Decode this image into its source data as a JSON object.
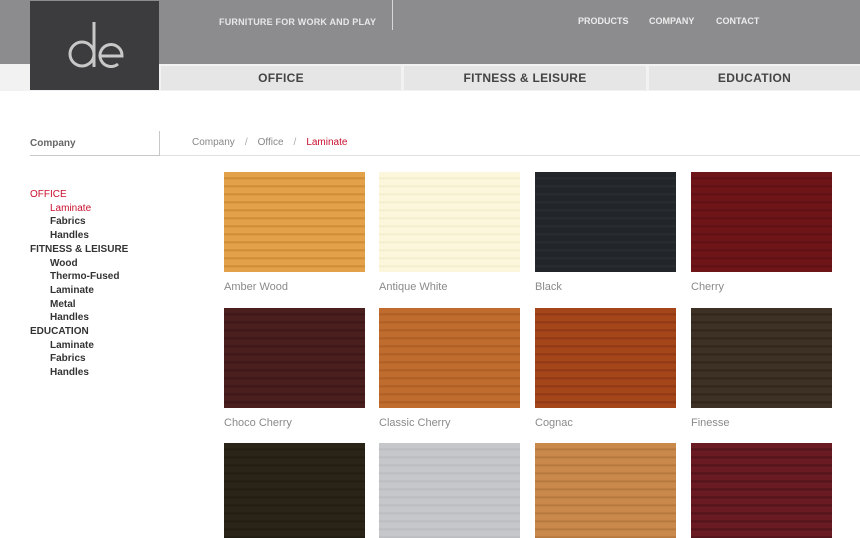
{
  "header": {
    "logo_text": "d&e",
    "tagline": "FURNITURE FOR WORK AND PLAY",
    "nav": [
      "PRODUCTS",
      "COMPANY",
      "CONTACT"
    ]
  },
  "tabs": [
    "OFFICE",
    "FITNESS & LEISURE",
    "EDUCATION"
  ],
  "sidebar": {
    "title": "Company",
    "sections": [
      {
        "label": "OFFICE",
        "items": [
          "Laminate",
          "Fabrics",
          "Handles"
        ]
      },
      {
        "label": "FITNESS & LEISURE",
        "items": [
          "Wood",
          "Thermo-Fused",
          "Laminate",
          "Metal",
          "Handles"
        ]
      },
      {
        "label": "EDUCATION",
        "items": [
          "Laminate",
          "Fabrics",
          "Handles"
        ]
      }
    ]
  },
  "breadcrumb": {
    "items": [
      "Company",
      "Office",
      "Laminate"
    ],
    "separator": "/"
  },
  "swatches": [
    {
      "label": "Amber Wood",
      "color": "#e3a24a",
      "stripe": "#c98530"
    },
    {
      "label": "Antique White",
      "color": "#fbf6dc",
      "stripe": "#f1ebc9"
    },
    {
      "label": "Black",
      "color": "#22262a",
      "stripe": "#2b3034"
    },
    {
      "label": "Cherry",
      "color": "#6e1518",
      "stripe": "#5a0f12"
    },
    {
      "label": "Choco Cherry",
      "color": "#4a1f1e",
      "stripe": "#3a1615"
    },
    {
      "label": "Classic Cherry",
      "color": "#c06c2e",
      "stripe": "#a95a22"
    },
    {
      "label": "Cognac",
      "color": "#a4451a",
      "stripe": "#8a3512"
    },
    {
      "label": "Finesse",
      "color": "#3d3024",
      "stripe": "#2e2419"
    },
    {
      "label": "",
      "color": "#2a2418",
      "stripe": "#1f1a10"
    },
    {
      "label": "",
      "color": "#c5c7ca",
      "stripe": "#b8babd"
    },
    {
      "label": "",
      "color": "#c8894a",
      "stripe": "#b2733a"
    },
    {
      "label": "",
      "color": "#6a1a22",
      "stripe": "#4c1018"
    }
  ],
  "colors": {
    "accent": "#c8102e",
    "header_bg": "#8c8c8e",
    "logo_bg": "#3c3c3e"
  }
}
